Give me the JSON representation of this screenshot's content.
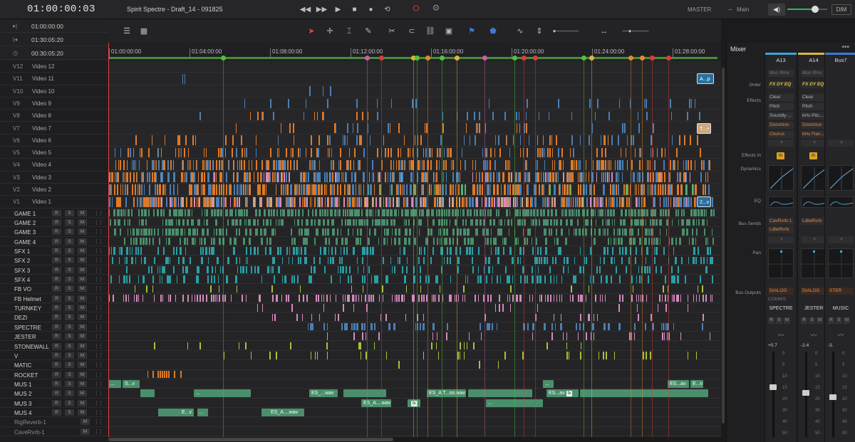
{
  "topbar": {
    "timecode": "01:00:00:03",
    "project_title": "Spirit Spectre - Draft_14 - 091825",
    "master": "MASTER",
    "arrow": "→",
    "main": "Main",
    "dim": "DIM",
    "volume_level": 0.7
  },
  "tc_panel": {
    "rows": [
      {
        "icon": "in-point-icon",
        "glyph": "▸|",
        "value": "01:00:00:00"
      },
      {
        "icon": "out-point-icon",
        "glyph": "|◂",
        "value": "01:30:05:20"
      },
      {
        "icon": "clock-icon",
        "glyph": "◷",
        "value": "00:30:05:20"
      }
    ]
  },
  "ruler": {
    "ticks": [
      "01:00:00:00",
      "01:04:00:00",
      "01:08:00:00",
      "01:12:00:00",
      "01:16:00:00",
      "01:20:00:00",
      "01:24:00:00",
      "01:28:00:00"
    ]
  },
  "video_tracks": [
    {
      "id": "V12",
      "name": "Video 12"
    },
    {
      "id": "V11",
      "name": "Video 11"
    },
    {
      "id": "V10",
      "name": "Video 10"
    },
    {
      "id": "V9",
      "name": "Video 9"
    },
    {
      "id": "V8",
      "name": "Video 8"
    },
    {
      "id": "V7",
      "name": "Video 7"
    },
    {
      "id": "V6",
      "name": "Video 6"
    },
    {
      "id": "V5",
      "name": "Video 5"
    },
    {
      "id": "V4",
      "name": "Video 4"
    },
    {
      "id": "V3",
      "name": "Video 3"
    },
    {
      "id": "V2",
      "name": "Video 2"
    },
    {
      "id": "V1",
      "name": "Video 1"
    }
  ],
  "audio_tracks": [
    {
      "name": "GAME 1"
    },
    {
      "name": "GAME 2"
    },
    {
      "name": "GAME 3"
    },
    {
      "name": "GAME 4"
    },
    {
      "name": "SFX 1"
    },
    {
      "name": "SFX 2"
    },
    {
      "name": "SFX 3"
    },
    {
      "name": "SFX 4"
    },
    {
      "name": "FB VO"
    },
    {
      "name": "FB Helmet"
    },
    {
      "name": "TURNKEY"
    },
    {
      "name": "DEZI"
    },
    {
      "name": "SPECTRE"
    },
    {
      "name": "JESTER"
    },
    {
      "name": "STONEWALL"
    },
    {
      "name": "V"
    },
    {
      "name": "MATIC"
    },
    {
      "name": "ROCKET"
    },
    {
      "name": "MUS 1"
    },
    {
      "name": "MUS 2"
    },
    {
      "name": "MUS 3"
    },
    {
      "name": "MUS 4"
    }
  ],
  "bus_tracks": [
    {
      "name": "RigReverb-1"
    },
    {
      "name": "CaveRvrb-1"
    }
  ],
  "track_buttons": {
    "r": "R",
    "s": "S",
    "m": "M"
  },
  "clip_labels": {
    "v11": "A...p",
    "v7": "T...+",
    "v1": "2...v",
    "mus1_a": "S...v",
    "mus1_b": "ES...av",
    "mus1_c": "E...v",
    "mus2_a": "ES_...wav",
    "mus2_b": "ES_A T...on.wav",
    "mus2_c": "ES...av",
    "mus3_a": "ES_A....wav",
    "mus4_a": "E...v",
    "mus4_b": "ES_A....wav",
    "fx": "fx",
    "ellipsis": "..."
  },
  "mixer": {
    "title": "Mixer",
    "more": "•••",
    "row_labels": {
      "order": "Order",
      "effects": "Effects",
      "effects_in": "Effects In",
      "dynamics": "Dynamics",
      "eq": "EQ",
      "bus_sends": "Bus Sends",
      "pan": "Pan",
      "bus_outputs": "Bus Outputs"
    },
    "strips": [
      {
        "id": "A13",
        "color": "#3aa4d8",
        "order_top": "Mus Rmx",
        "order_fx": "FX DY EQ",
        "effects": [
          "Clear",
          "Pitch",
          "Soundly ...",
          "Distortion",
          "Chorus"
        ],
        "plus": "+",
        "in": "In",
        "sends": [
          "CavRvrb-1",
          "LdlwRvrb"
        ],
        "bus_out": "DIALOG",
        "comms": "COMMS",
        "name": "SPECTRE",
        "gain": "+0.7",
        "fader_level": 0.62
      },
      {
        "id": "A14",
        "color": "#d8b73a",
        "order_top": "Mus Rmx",
        "order_fx": "FX DY EQ",
        "effects": [
          "Clear",
          "Pitch",
          "kHs Pitc...",
          "Distortion",
          "kHs Flan..."
        ],
        "plus": "+",
        "in": "In",
        "sends": [
          "LdlwRvrb"
        ],
        "bus_out": "DIALOG",
        "comms": "",
        "name": "JESTER",
        "gain": "-2.4",
        "fader_level": 0.55
      },
      {
        "id": "Bus7",
        "color": "#3a7bd8",
        "order_top": "",
        "order_fx": "",
        "effects": [],
        "plus": "+",
        "in": "",
        "sends": [],
        "bus_out": "STER",
        "comms": "",
        "name": "MUSIC",
        "gain": "-3.",
        "fader_level": 0.5
      }
    ],
    "fader_scale": [
      "0",
      "5",
      "10",
      "15",
      "20",
      "30",
      "40",
      "50"
    ]
  },
  "colors": {
    "orange": "#e07a26",
    "blue": "#4a7fb5",
    "pink": "#d88ac0",
    "green": "#5bb56a",
    "teal": "#2a9fa5",
    "lime": "#a8c23a",
    "tan": "#c9a880",
    "audio_green": "#4a8f6b"
  }
}
